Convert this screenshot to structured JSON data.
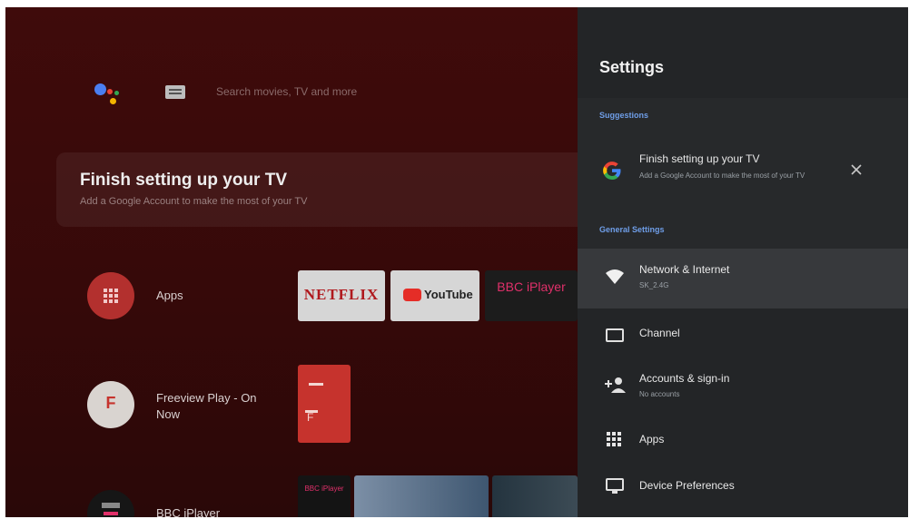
{
  "home": {
    "search": {
      "placeholder": "Search movies, TV and more"
    },
    "setup_card": {
      "title": "Finish setting up your TV",
      "subtitle": "Add a Google Account to make the most of your TV"
    },
    "rows": [
      {
        "label": "Apps",
        "icon": "apps-grid-icon"
      },
      {
        "label": "Freeview Play - On Now",
        "icon": "freeview-logo-icon"
      },
      {
        "label": "BBC iPlayer",
        "icon": "bbc-iplayer-logo-icon"
      }
    ],
    "app_tiles": [
      {
        "label": "NETFLIX",
        "bg": "#d6d6d6",
        "color": "#b0191e"
      },
      {
        "label": "YouTube",
        "bg": "#d6d6d6",
        "color": "#222222"
      },
      {
        "label": "BBC iPlayer",
        "bg": "#1c1c1c",
        "color": "#e0306a"
      }
    ],
    "freeview_tile": {
      "bg": "#c6332d"
    },
    "iplayer_tile": {
      "label": "BBC iPlayer"
    }
  },
  "settings": {
    "title": "Settings",
    "suggestions_header": "Suggestions",
    "suggestion": {
      "title": "Finish setting up your TV",
      "subtitle": "Add a Google Account to make the most of your TV",
      "icon": "google-g-icon",
      "dismiss_icon": "close-icon"
    },
    "general_header": "General Settings",
    "items": [
      {
        "title": "Network & Internet",
        "subtitle": "SK_2.4G",
        "icon": "wifi-icon"
      },
      {
        "title": "Channel",
        "subtitle": "",
        "icon": "tv-icon"
      },
      {
        "title": "Accounts & sign-in",
        "subtitle": "No accounts",
        "icon": "add-person-icon"
      },
      {
        "title": "Apps",
        "subtitle": "",
        "icon": "apps-grid-icon"
      },
      {
        "title": "Device Preferences",
        "subtitle": "",
        "icon": "monitor-icon"
      }
    ]
  },
  "colors": {
    "accent_blue": "#6f9ee8",
    "home_bg": "#3a0a0a",
    "panel_bg": "#232527",
    "highlight": "#2b2d30"
  }
}
